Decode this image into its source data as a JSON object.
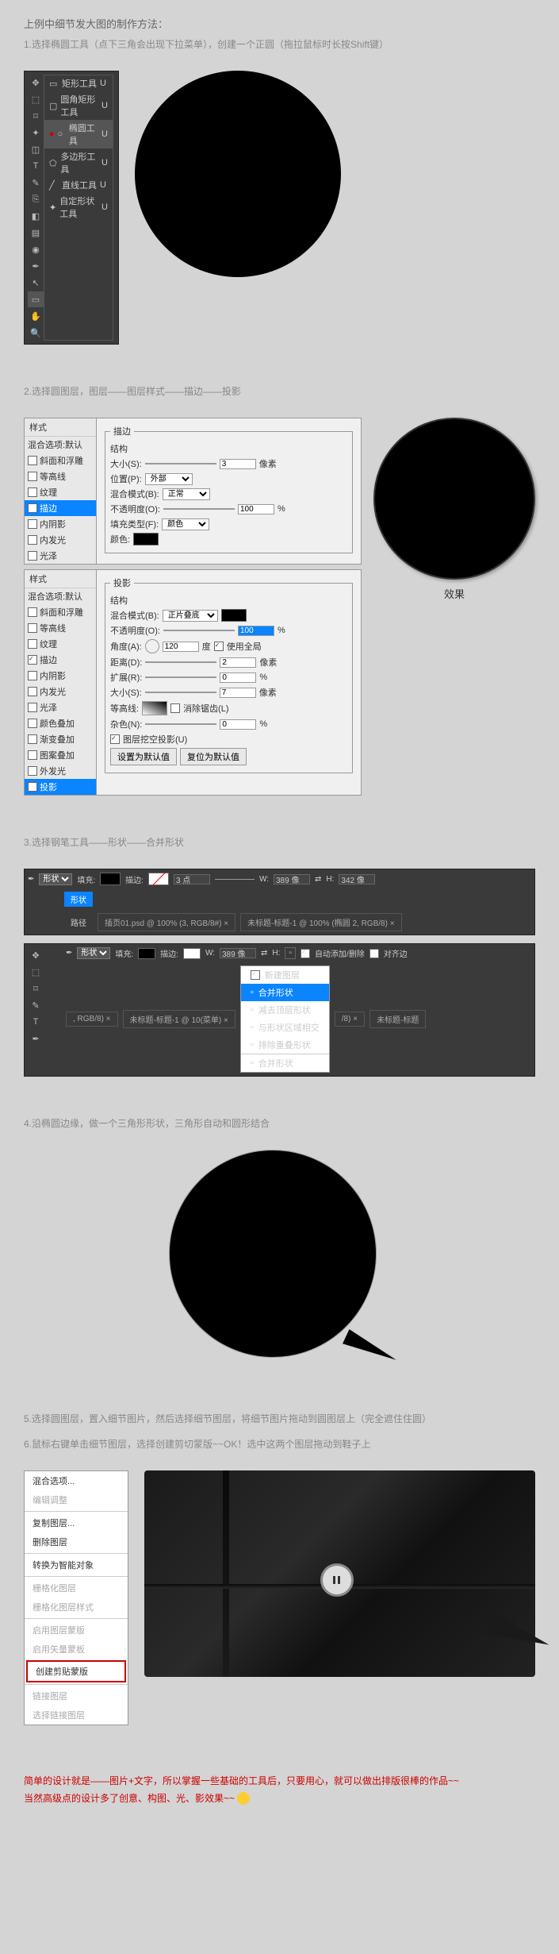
{
  "intro": {
    "title": "上例中细节发大图的制作方法：",
    "step1": "1.选择椭圆工具（点下三角会出现下拉菜单），创建一个正圆（拖拉鼠标时长按Shift键）"
  },
  "tools": {
    "fly": [
      "矩形工具",
      "圆角矩形工具",
      "椭圆工具",
      "多边形工具",
      "直线工具",
      "自定形状工具"
    ],
    "shortcut": "U"
  },
  "step2": {
    "heading": "2.选择圆图层，图层——图层样式——描边——投影",
    "side_hd": "样式",
    "side_sub": "混合选项:默认",
    "side1": [
      "斜面和浮雕",
      "等高线",
      "纹理",
      "描边",
      "内阴影",
      "内发光",
      "光泽"
    ],
    "side2": [
      "斜面和浮雕",
      "等高线",
      "纹理",
      "描边",
      "内阴影",
      "内发光",
      "光泽",
      "颜色叠加",
      "渐变叠加",
      "图案叠加",
      "外发光",
      "投影"
    ],
    "stroke_legend": "描边",
    "struct": "结构",
    "size": "大小(S):",
    "size_v": "3",
    "px": "像素",
    "pos": "位置(P):",
    "pos_v": "外部",
    "blend": "混合模式(B):",
    "blend_v": "正常",
    "opacity": "不透明度(O):",
    "opacity_v": "100",
    "pct": "%",
    "fill_type": "填充类型(F):",
    "fill_v": "颜色",
    "color": "颜色:",
    "shadow_legend": "投影",
    "blend2_v": "正片叠底",
    "opacity2_v": "100",
    "angle": "角度(A):",
    "angle_v": "120",
    "deg": "度",
    "global": "使用全局",
    "dist": "距离(D):",
    "dist_v": "2",
    "spread": "扩展(R):",
    "spread_v": "0",
    "size2": "大小(S):",
    "size2_v": "7",
    "contour": "等高线:",
    "anti": "消除锯齿(L)",
    "noise": "杂色(N):",
    "noise_v": "0",
    "knockout": "图层挖空投影(U)",
    "default_btn": "设置为默认值",
    "reset_btn": "复位为默认值",
    "result": "效果"
  },
  "step3": {
    "heading": "3.选择钢笔工具——形状——合并形状",
    "mode": "形状",
    "path": "路径",
    "fill": "填充:",
    "stroke": "描边:",
    "stroke_w": "3 点",
    "w": "W:",
    "wv": "389 像",
    "h": "H:",
    "hv": "342 像",
    "tab1": "插页01.psd @ 100% (3, RGB/8#) ×",
    "tab2": "未标题-标题-1 @ 100% (椭圆 2, RGB/8) ×",
    "auto": "自动添加/删除",
    "align": "对齐边",
    "tab3": ", RGB/8) ×",
    "tab4": "未标题-标题-1 @ 10(菜单) ×",
    "tab5": "未标题-标题",
    "menu": [
      "新建图层",
      "合并形状",
      "减去顶层形状",
      "与形状区域相交",
      "排除重叠形状",
      "合并形状"
    ]
  },
  "step4": {
    "heading": "4.沿椭圆边缘，做一个三角形形状，三角形自动和圆形结合"
  },
  "step5": "5.选择圆图层，置入细节图片，然后选择细节图层，将细节图片拖动到圆图层上（完全遮住住圆）",
  "step6": "6.鼠标右键单击细节图层，选择创建剪切蒙版~~OK！选中这两个图层拖动到鞋子上",
  "ctx2": [
    "混合选项...",
    "编辑调整",
    "复制图层...",
    "删除图层",
    "转换为智能对象",
    "栅格化图层",
    "栅格化图层样式",
    "启用图层蒙版",
    "启用矢量蒙板",
    "创建剪贴蒙版",
    "链接图层",
    "选择链接图层"
  ],
  "footer": {
    "l1": "简单的设计就是——图片+文字，所以掌握一些基础的工具后，只要用心，就可以做出排版很棒的作品~~",
    "l2": "当然高级点的设计多了创意、构图、光、影效果~~ "
  }
}
